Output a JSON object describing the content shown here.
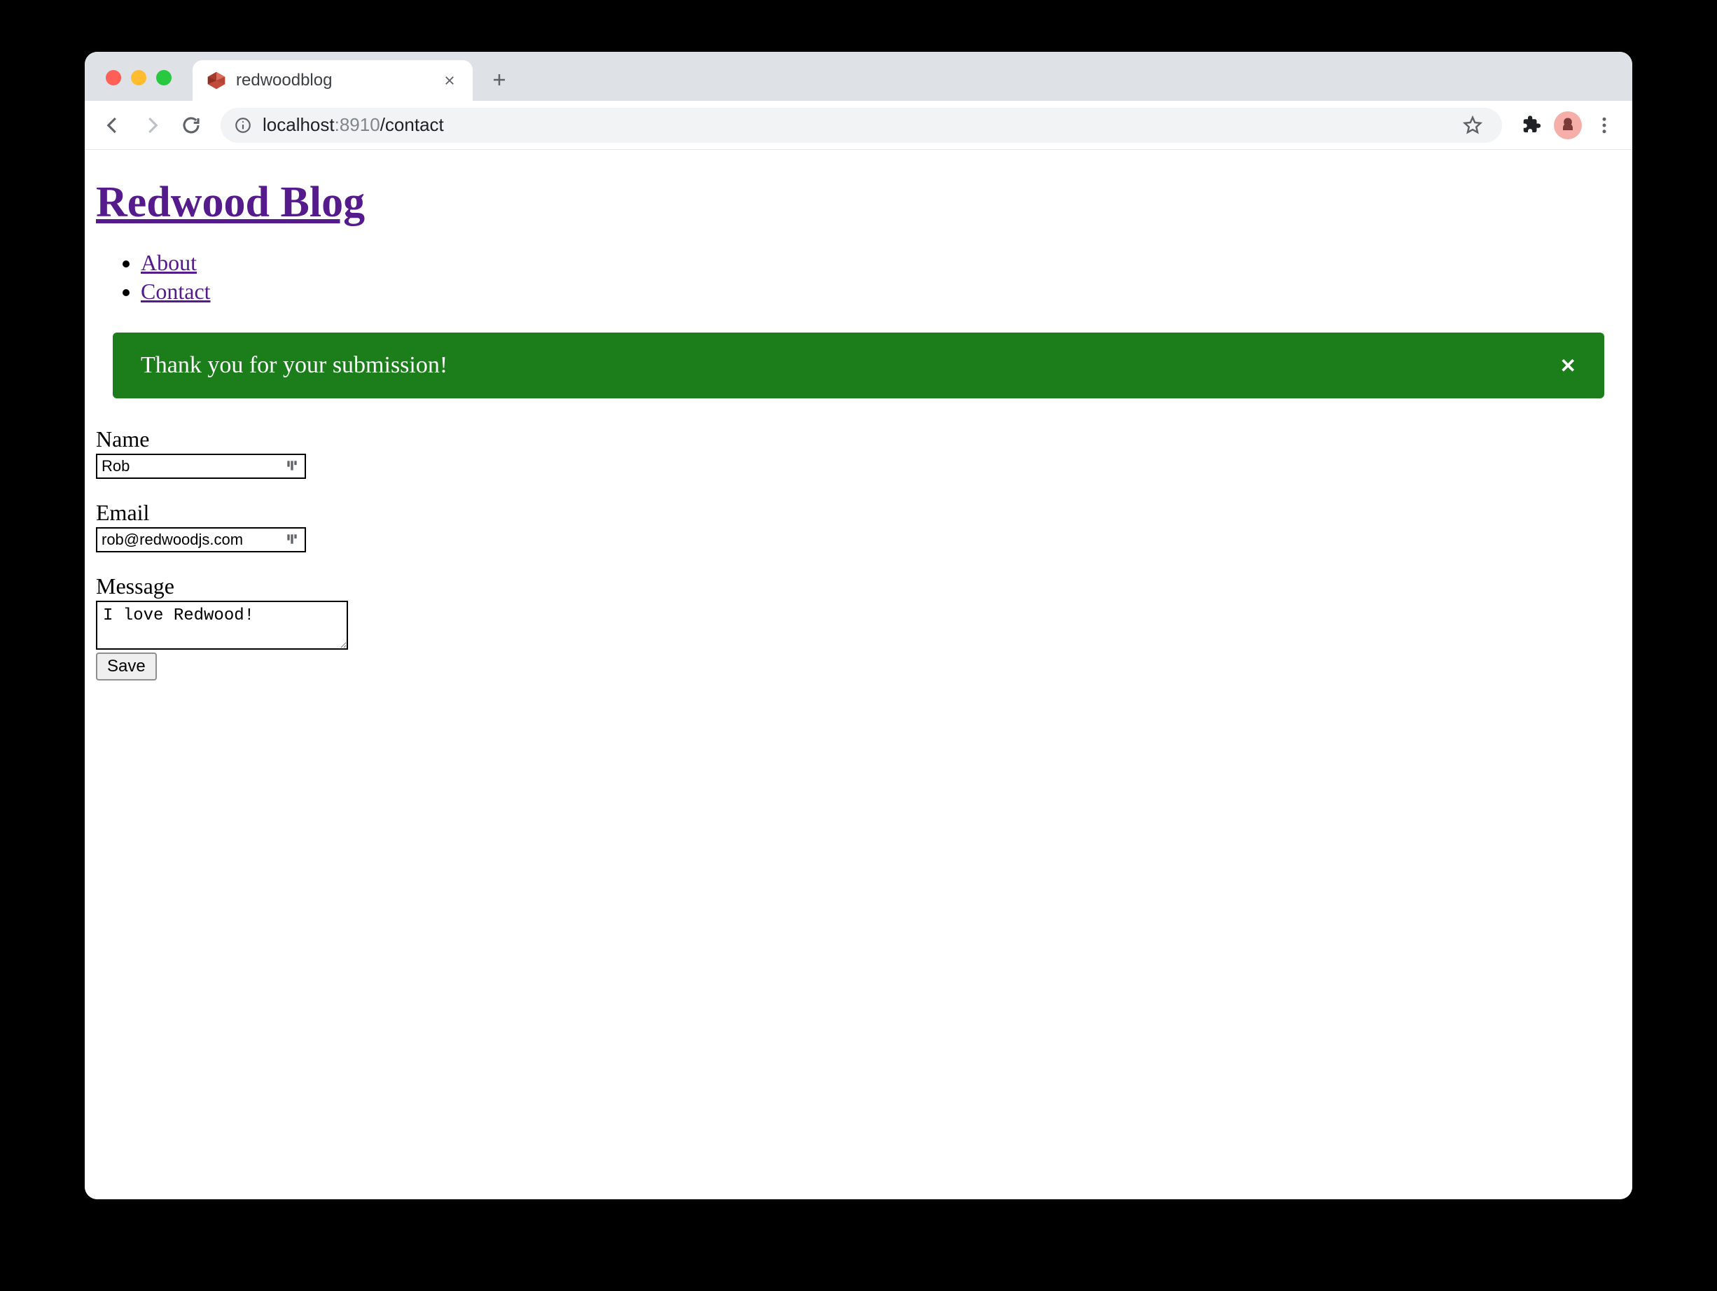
{
  "browser": {
    "tab_title": "redwoodblog",
    "url_host": "localhost",
    "url_port": ":8910",
    "url_path": "/contact"
  },
  "page": {
    "site_title": "Redwood Blog",
    "nav": [
      {
        "label": "About"
      },
      {
        "label": "Contact"
      }
    ],
    "toast": {
      "message": "Thank you for your submission!",
      "close_glyph": "✕"
    },
    "form": {
      "name_label": "Name",
      "name_value": "Rob",
      "email_label": "Email",
      "email_value": "rob@redwoodjs.com",
      "message_label": "Message",
      "message_value": "I love Redwood!",
      "submit_label": "Save"
    }
  }
}
